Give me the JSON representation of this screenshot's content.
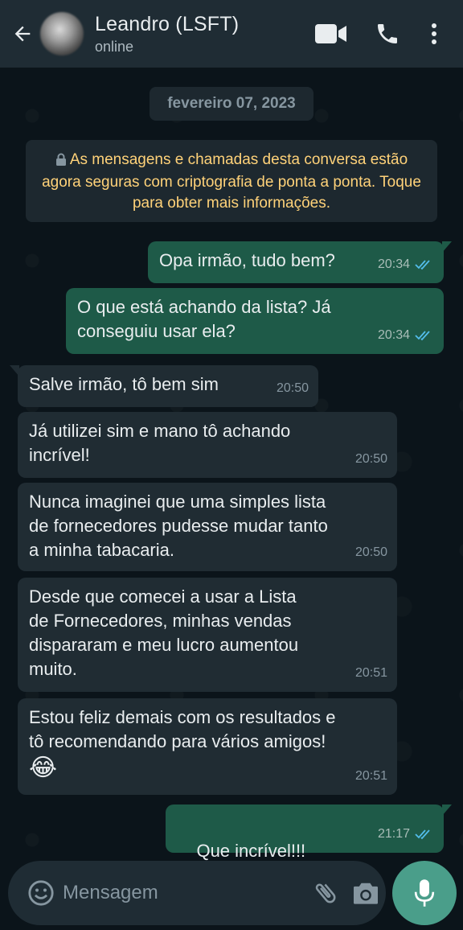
{
  "header": {
    "contact_name": "Leandro (LSFT)",
    "status": "online"
  },
  "chat": {
    "date_chip": "fevereiro 07, 2023",
    "encryption_notice": "As mensagens e chamadas desta conversa estão agora seguras com criptografia de ponta a ponta. Toque para obter mais informações.",
    "messages": [
      {
        "direction": "out",
        "text": "Opa irmão, tudo bem?",
        "time": "20:34",
        "status": "read"
      },
      {
        "direction": "out",
        "text": "O que está achando da lista? Já\nconseguiu usar ela?",
        "time": "20:34",
        "status": "read"
      },
      {
        "direction": "in",
        "text": "Salve irmão, tô bem sim",
        "time": "20:50"
      },
      {
        "direction": "in",
        "text": "Já utilizei sim e mano tô achando\nincrível!",
        "time": "20:50"
      },
      {
        "direction": "in",
        "text": "Nunca imaginei que uma simples lista\nde fornecedores pudesse mudar tanto\na minha tabacaria.",
        "time": "20:50"
      },
      {
        "direction": "in",
        "text": "Desde que comecei a usar a Lista\nde Fornecedores, minhas vendas\ndispararam e meu lucro aumentou\nmuito.",
        "time": "20:51"
      },
      {
        "direction": "in",
        "text": "Estou feliz demais com os resultados e\ntô recomendando para vários amigos!",
        "emoji": "😂",
        "time": "20:51"
      },
      {
        "direction": "out",
        "text": "Que incrível!!!",
        "emoji": "🙌🏻🙌🏻🙌🏻",
        "time": "21:17",
        "status": "read"
      }
    ]
  },
  "input": {
    "placeholder": "Mensagem"
  },
  "colors": {
    "header_bg": "#1f2c34",
    "chat_bg": "#0b141a",
    "outgoing_bubble": "#1e5a48",
    "incoming_bubble": "#202c33",
    "read_ticks": "#53bdeb",
    "encryption_text": "#ffd279",
    "mic_button": "#4a9e8a"
  },
  "icons": {
    "back": "arrow-left-icon",
    "video": "video-camera-icon",
    "call": "phone-icon",
    "menu": "more-vertical-icon",
    "emoji": "smiley-icon",
    "attach": "paperclip-icon",
    "camera": "camera-icon",
    "mic": "microphone-icon",
    "lock": "lock-icon",
    "read": "double-check-icon"
  }
}
